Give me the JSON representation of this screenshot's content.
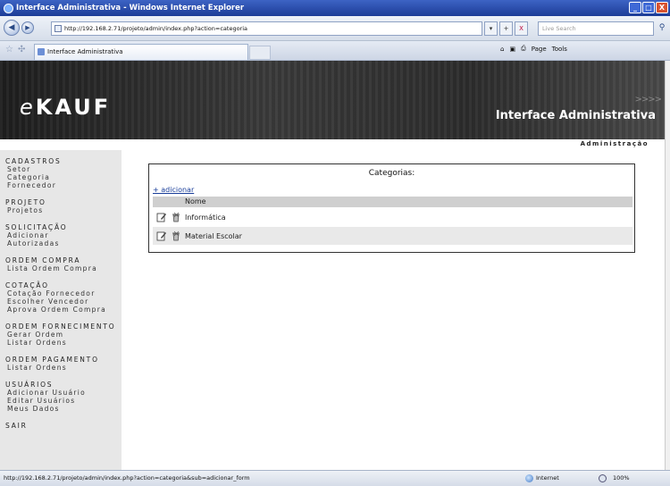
{
  "window": {
    "title": "Interface Administrativa - Windows Internet Explorer",
    "minimize": "_",
    "maximize": "□",
    "close": "X"
  },
  "addressbar": {
    "url": "http://192.168.2.71/projeto/admin/index.php?action=categoria",
    "search_placeholder": "Live Search",
    "refresh": "+",
    "stop": "X"
  },
  "tabbar": {
    "tab_title": "Interface Administrativa",
    "commands": {
      "home": "⌂",
      "feeds": "▣",
      "print": "⎙",
      "page": "Page",
      "tools": "Tools"
    }
  },
  "banner": {
    "logo_prefix": "e",
    "logo_rest": "KAUF",
    "title": "Interface Administrativa",
    "arrows": ">>>>"
  },
  "adminbar": {
    "label": "Administração"
  },
  "sidebar": {
    "groups": [
      {
        "head": "CADASTROS",
        "items": [
          "Setor",
          "Categoria",
          "Fornecedor"
        ]
      },
      {
        "head": "PROJETO",
        "items": [
          "Projetos"
        ]
      },
      {
        "head": "SOLICITAÇÃO",
        "items": [
          "Adicionar",
          "Autorizadas"
        ]
      },
      {
        "head": "ORDEM COMPRA",
        "items": [
          "Lista Ordem Compra"
        ]
      },
      {
        "head": "COTAÇÃO",
        "items": [
          "Cotação Fornecedor",
          "Escolher Vencedor",
          "Aprova Ordem Compra"
        ]
      },
      {
        "head": "ORDEM FORNECIMENTO",
        "items": [
          "Gerar Ordem",
          "Listar Ordens"
        ]
      },
      {
        "head": "ORDEM PAGAMENTO",
        "items": [
          "Listar Ordens"
        ]
      },
      {
        "head": "USUÁRIOS",
        "items": [
          "Adicionar Usuário",
          "Editar Usuários",
          "Meus Dados"
        ]
      },
      {
        "head": "SAIR",
        "items": []
      }
    ]
  },
  "main": {
    "panel_title": "Categorias:",
    "add_link": "+ adicionar",
    "column_name": "Nome",
    "rows": [
      {
        "name": "Informática"
      },
      {
        "name": "Material Escolar"
      }
    ]
  },
  "statusbar": {
    "url": "http://192.168.2.71/projeto/admin/index.php?action=categoria&sub=adicionar_form",
    "zone": "Internet",
    "zoom": "100%"
  },
  "colors": {
    "banner_dark": "#1e1e1e",
    "sidebar_bg": "#e7e7e7",
    "grid_header": "#cfcfcf",
    "link": "#1a3e9a"
  }
}
